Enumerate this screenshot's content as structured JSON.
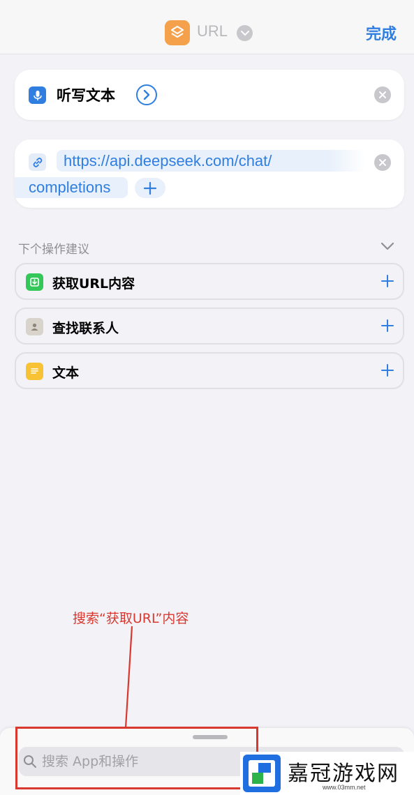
{
  "header": {
    "title": "URL",
    "done_label": "完成",
    "app_icon": "shortcuts-icon",
    "app_icon_color": "#f5a04a"
  },
  "actions": {
    "dictate": {
      "label": "听写文本",
      "icon": "microphone-icon",
      "icon_color": "#2f7ee0"
    },
    "url": {
      "line1": "https://api.deepseek.com/chat/",
      "line2": "completions",
      "icon": "link-icon"
    }
  },
  "suggestions": {
    "header": "下个操作建议",
    "items": [
      {
        "label": "获取URL内容",
        "icon": "download-icon",
        "color": "#34c759"
      },
      {
        "label": "查找联系人",
        "icon": "contacts-icon",
        "color": "#d8d3cb"
      },
      {
        "label": "文本",
        "icon": "text-doc-icon",
        "color": "#f7c234"
      }
    ]
  },
  "annotation": {
    "text": "搜索“获取URL”内容",
    "color": "#d9382f"
  },
  "search": {
    "placeholder": "搜索 App和操作"
  },
  "watermark": {
    "text": "嘉冠游戏网",
    "url": "www.03mm.net"
  },
  "colors": {
    "accent": "#2f7ee0",
    "background": "#f2f2f7"
  }
}
